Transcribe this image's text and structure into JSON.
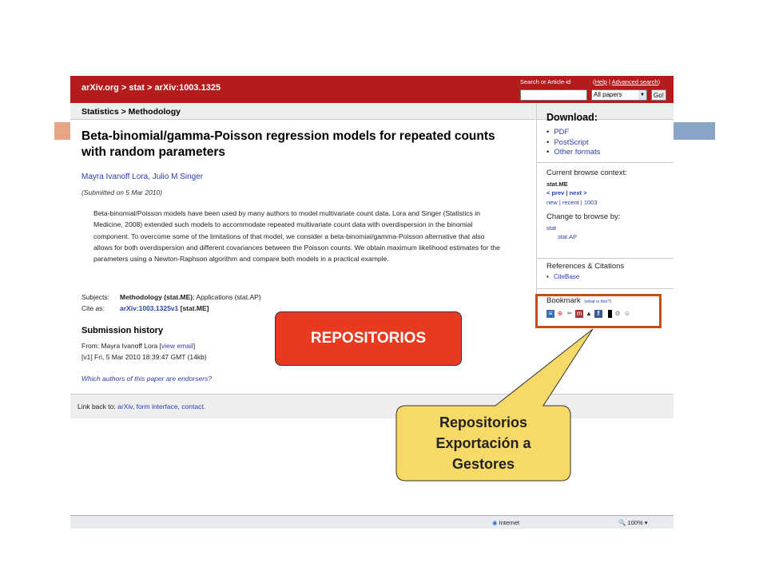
{
  "colors": {
    "header": "#b41b1b",
    "highlight_box": "#c0501e",
    "repo_button": "#e73a1e",
    "callout_fill": "#f7d967",
    "link": "#2a3fb0"
  },
  "header": {
    "breadcrumb": "arXiv.org > stat > arXiv:1003.1325",
    "search_label": "Search or Article-id",
    "help": "Help",
    "advanced": "Advanced search",
    "select_value": "All papers",
    "go": "Go!"
  },
  "section": "Statistics > Methodology",
  "paper": {
    "title": "Beta-binomial/gamma-Poisson regression models for repeated counts with random parameters",
    "authors": "Mayra Ivanoff Lora, Julio M Singer",
    "submitted": "(Submitted on 5 Mar 2010)",
    "abstract": "Beta-binomial/Poisson models have been used by many authors to model multivariate count data. Lora and Singer (Statistics in Medicine, 2008) extended such models to accommodate repeated multivariate count data with overdispersion in the binomial component. To overcome some of the limitations of that model, we consider a beta-binomial/gamma-Poisson alternative that also allows for both overdispersion and different covariances between the Poisson counts. We obtain maximum likelihood estimates for the parameters using a Newton-Raphson algorithm and compare both models in a practical example.",
    "subjects_label": "Subjects:",
    "subjects_primary": "Methodology (stat.ME)",
    "subjects_rest": "; Applications (stat.AP)",
    "cite_label": "Cite as:",
    "cite_id": "arXiv:1003.1325v1",
    "cite_rest": " [stat.ME]"
  },
  "history": {
    "title": "Submission history",
    "from": "From: Mayra Ivanoff Lora [",
    "view_email": "view email",
    "from_end": "]",
    "v1": "[v1] Fri, 5 Mar 2010 18:39:47 GMT (14kb)",
    "endorsers": "Which authors of this paper are endorsers?"
  },
  "footer": {
    "prefix": "Link back to: ",
    "arxiv": "arXiv",
    "form": "form interface",
    "contact": "contact",
    "sep": ", ",
    "end": "."
  },
  "sidebar": {
    "download_title": "Download:",
    "formats": [
      "PDF",
      "PostScript",
      "Other formats"
    ],
    "context_title": "Current browse context:",
    "context_value": "stat.ME",
    "prev_next": "< prev | next >",
    "recent": "new | recent | 1003",
    "change_title": "Change to browse by:",
    "browse1": "stat",
    "browse2": "stat.AP",
    "refs_title": "References & Citations",
    "citebase": "CiteBase",
    "bookmark_title": "Bookmark",
    "what_is_this": "(what is this?)"
  },
  "status": {
    "internet": "Internet",
    "zoom": "100%"
  },
  "overlay": {
    "repositorios": "REPOSITORIOS",
    "callout_line1": "Repositorios",
    "callout_line2": "Exportación a",
    "callout_line3": "Gestores"
  }
}
